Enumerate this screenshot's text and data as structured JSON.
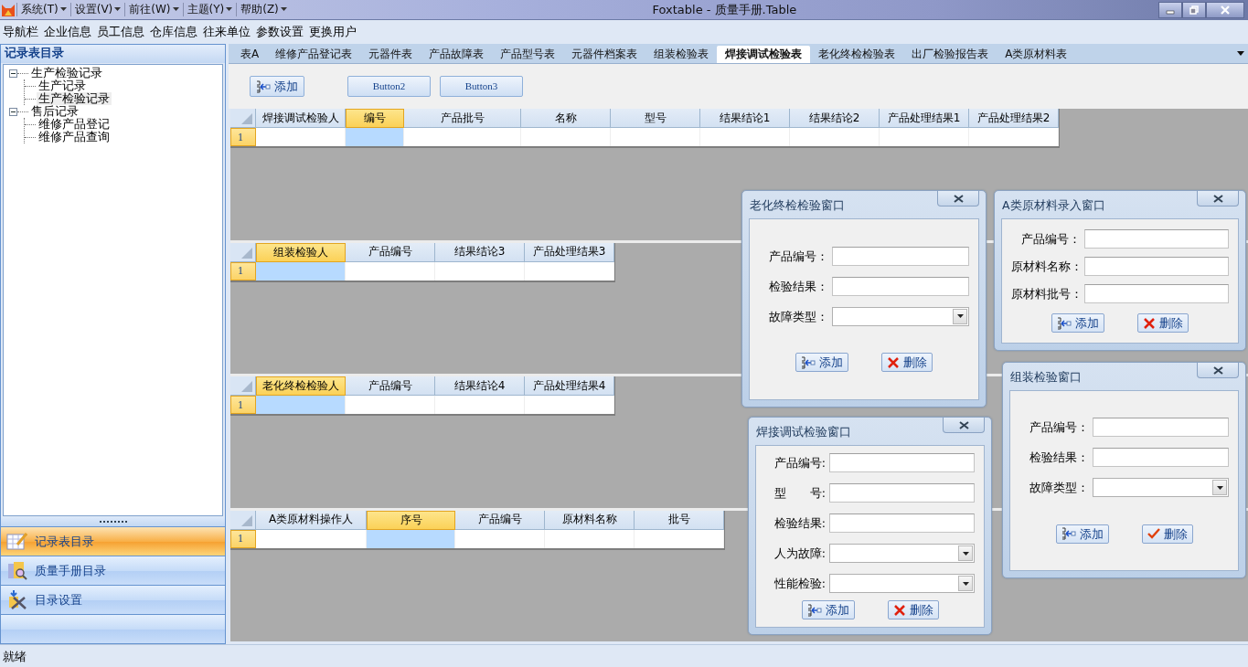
{
  "window": {
    "title": "Foxtable - 质量手册.Table",
    "menus": [
      {
        "label": "系统(T)"
      },
      {
        "label": "设置(V)"
      },
      {
        "label": "前往(W)"
      },
      {
        "label": "主题(Y)"
      },
      {
        "label": "帮助(Z)"
      }
    ]
  },
  "nav_bar": [
    "导航栏",
    "企业信息",
    "员工信息",
    "仓库信息",
    "往来单位",
    "参数设置",
    "更换用户"
  ],
  "sidebar": {
    "title": "记录表目录",
    "tree": [
      {
        "label": "生产检验记录",
        "expanded": true,
        "selected": false,
        "children": [
          {
            "label": "生产记录",
            "selected": false
          },
          {
            "label": "生产检验记录",
            "selected": true
          }
        ]
      },
      {
        "label": "售后记录",
        "expanded": true,
        "selected": false,
        "children": [
          {
            "label": "维修产品登记",
            "selected": false
          },
          {
            "label": "维修产品查询",
            "selected": false
          }
        ]
      }
    ],
    "nav_buttons": [
      {
        "label": "记录表目录",
        "selected": true
      },
      {
        "label": "质量手册目录",
        "selected": false
      },
      {
        "label": "目录设置",
        "selected": false
      }
    ]
  },
  "tabs": [
    {
      "label": "表A",
      "selected": false
    },
    {
      "label": "维修产品登记表",
      "selected": false
    },
    {
      "label": "元器件表",
      "selected": false
    },
    {
      "label": "产品故障表",
      "selected": false
    },
    {
      "label": "产品型号表",
      "selected": false
    },
    {
      "label": "元器件档案表",
      "selected": false
    },
    {
      "label": "组装检验表",
      "selected": false
    },
    {
      "label": "焊接调试检验表",
      "selected": true
    },
    {
      "label": "老化终检检验表",
      "selected": false
    },
    {
      "label": "出厂检验报告表",
      "selected": false
    },
    {
      "label": "A类原材料表",
      "selected": false
    }
  ],
  "toolbar": {
    "buttons": [
      {
        "label": "添加",
        "kind": "add"
      },
      {
        "label": "Button2",
        "kind": "plain"
      },
      {
        "label": "Button3",
        "kind": "plain"
      }
    ]
  },
  "grids": [
    {
      "columns": [
        {
          "label": "焊接调试检验人",
          "selected": false
        },
        {
          "label": "编号",
          "selected": true
        },
        {
          "label": "产品批号",
          "selected": false
        },
        {
          "label": "名称",
          "selected": false
        },
        {
          "label": "型号",
          "selected": false
        },
        {
          "label": "结果结论1",
          "selected": false
        },
        {
          "label": "结果结论2",
          "selected": false
        },
        {
          "label": "产品处理结果1",
          "selected": false
        },
        {
          "label": "产品处理结果2",
          "selected": false
        }
      ],
      "rows": [
        "1"
      ]
    },
    {
      "columns": [
        {
          "label": "组装检验人",
          "selected": true
        },
        {
          "label": "产品编号",
          "selected": false
        },
        {
          "label": "结果结论3",
          "selected": false
        },
        {
          "label": "产品处理结果3",
          "selected": false
        }
      ],
      "rows": [
        "1"
      ]
    },
    {
      "columns": [
        {
          "label": "老化终检检验人",
          "selected": true
        },
        {
          "label": "产品编号",
          "selected": false
        },
        {
          "label": "结果结论4",
          "selected": false
        },
        {
          "label": "产品处理结果4",
          "selected": false
        }
      ],
      "rows": [
        "1"
      ]
    },
    {
      "columns": [
        {
          "label": "A类原材料操作人",
          "selected": false
        },
        {
          "label": "序号",
          "selected": true
        },
        {
          "label": "产品编号",
          "selected": false
        },
        {
          "label": "原材料名称",
          "selected": false
        },
        {
          "label": "批号",
          "selected": false
        }
      ],
      "rows": [
        "1"
      ]
    }
  ],
  "dialogs": [
    {
      "title": "老化终检检验窗口",
      "fields": [
        {
          "label": "产品编号：",
          "kind": "text"
        },
        {
          "label": "检验结果：",
          "kind": "text"
        },
        {
          "label": "故障类型：",
          "kind": "combo"
        }
      ],
      "buttons": [
        {
          "label": "添加",
          "kind": "add"
        },
        {
          "label": "删除",
          "kind": "delete"
        }
      ]
    },
    {
      "title": "A类原材料录入窗口",
      "fields": [
        {
          "label": "产品编号：",
          "kind": "text"
        },
        {
          "label": "原材料名称：",
          "kind": "text"
        },
        {
          "label": "原材料批号：",
          "kind": "text"
        }
      ],
      "buttons": [
        {
          "label": "添加",
          "kind": "add"
        },
        {
          "label": "删除",
          "kind": "delete"
        }
      ]
    },
    {
      "title": "组装检验窗口",
      "fields": [
        {
          "label": "产品编号：",
          "kind": "text"
        },
        {
          "label": "检验结果：",
          "kind": "text"
        },
        {
          "label": "故障类型：",
          "kind": "combo"
        }
      ],
      "buttons": [
        {
          "label": "添加",
          "kind": "add"
        },
        {
          "label": "删除",
          "kind": "confirm"
        }
      ]
    },
    {
      "title": "焊接调试检验窗口",
      "fields": [
        {
          "label": "产品编号:",
          "kind": "text"
        },
        {
          "label": "型　　号:",
          "kind": "text"
        },
        {
          "label": "检验结果:",
          "kind": "text"
        },
        {
          "label": "人为故障:",
          "kind": "combo"
        },
        {
          "label": "性能检验:",
          "kind": "combo"
        }
      ],
      "buttons": [
        {
          "label": "添加",
          "kind": "add"
        },
        {
          "label": "删除",
          "kind": "delete"
        }
      ]
    }
  ],
  "status_bar": "就绪"
}
